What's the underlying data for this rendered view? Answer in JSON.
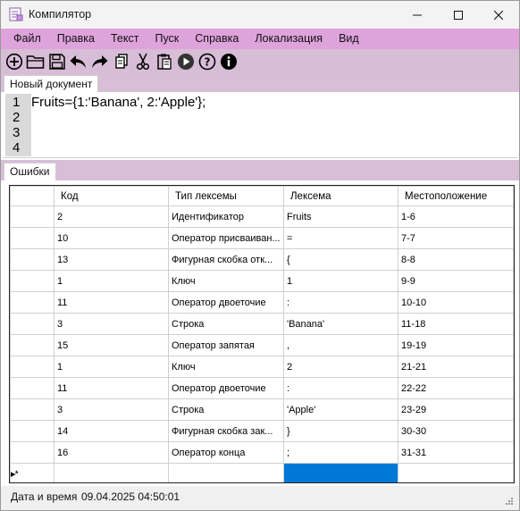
{
  "window": {
    "title": "Компилятор"
  },
  "menu": [
    {
      "id": "file",
      "label": "Файл"
    },
    {
      "id": "edit",
      "label": "Правка"
    },
    {
      "id": "text",
      "label": "Текст"
    },
    {
      "id": "run",
      "label": "Пуск"
    },
    {
      "id": "help",
      "label": "Справка"
    },
    {
      "id": "localization",
      "label": "Локализация"
    },
    {
      "id": "view",
      "label": "Вид"
    }
  ],
  "toolbar": {
    "icons": [
      "new-file-icon",
      "open-folder-icon",
      "save-icon",
      "undo-icon",
      "redo-icon",
      "copy-icon",
      "cut-icon",
      "paste-icon",
      "run-icon",
      "help-icon",
      "info-icon"
    ]
  },
  "editor": {
    "tab_label": "Новый документ",
    "line_numbers": [
      "1",
      "2",
      "3",
      "4"
    ],
    "code": "Fruits={1:'Banana', 2:'Apple'};"
  },
  "errors": {
    "tab_label": "Ошибки",
    "columns": [
      "Код",
      "Тип лексемы",
      "Лексема",
      "Местоположение"
    ],
    "rows": [
      [
        "2",
        "Идентификатор",
        "Fruits",
        "1-6"
      ],
      [
        "10",
        "Оператор присваиван...",
        "=",
        "7-7"
      ],
      [
        "13",
        "Фигурная скобка отк...",
        "{",
        "8-8"
      ],
      [
        "1",
        "Ключ",
        "1",
        "9-9"
      ],
      [
        "11",
        "Оператор двоеточие",
        ":",
        "10-10"
      ],
      [
        "3",
        "Строка",
        "'Banana'",
        "11-18"
      ],
      [
        "15",
        "Оператор запятая",
        ",",
        "19-19"
      ],
      [
        "1",
        "Ключ",
        "2",
        "21-21"
      ],
      [
        "11",
        "Оператор двоеточие",
        ":",
        "22-22"
      ],
      [
        "3",
        "Строка",
        "'Apple'",
        "23-29"
      ],
      [
        "14",
        "Фигурная скобка зак...",
        "}",
        "30-30"
      ],
      [
        "16",
        "Оператор конца",
        ";",
        "31-31"
      ]
    ],
    "new_row_marker": "▸*"
  },
  "status": {
    "label": "Дата и время",
    "value": "09.04.2025 04:50:01"
  },
  "colors": {
    "menubar": "#dfa3dc",
    "toolbar": "#d7bdd6",
    "tabstrip": "#d8bed7",
    "selection": "#0078d7"
  }
}
